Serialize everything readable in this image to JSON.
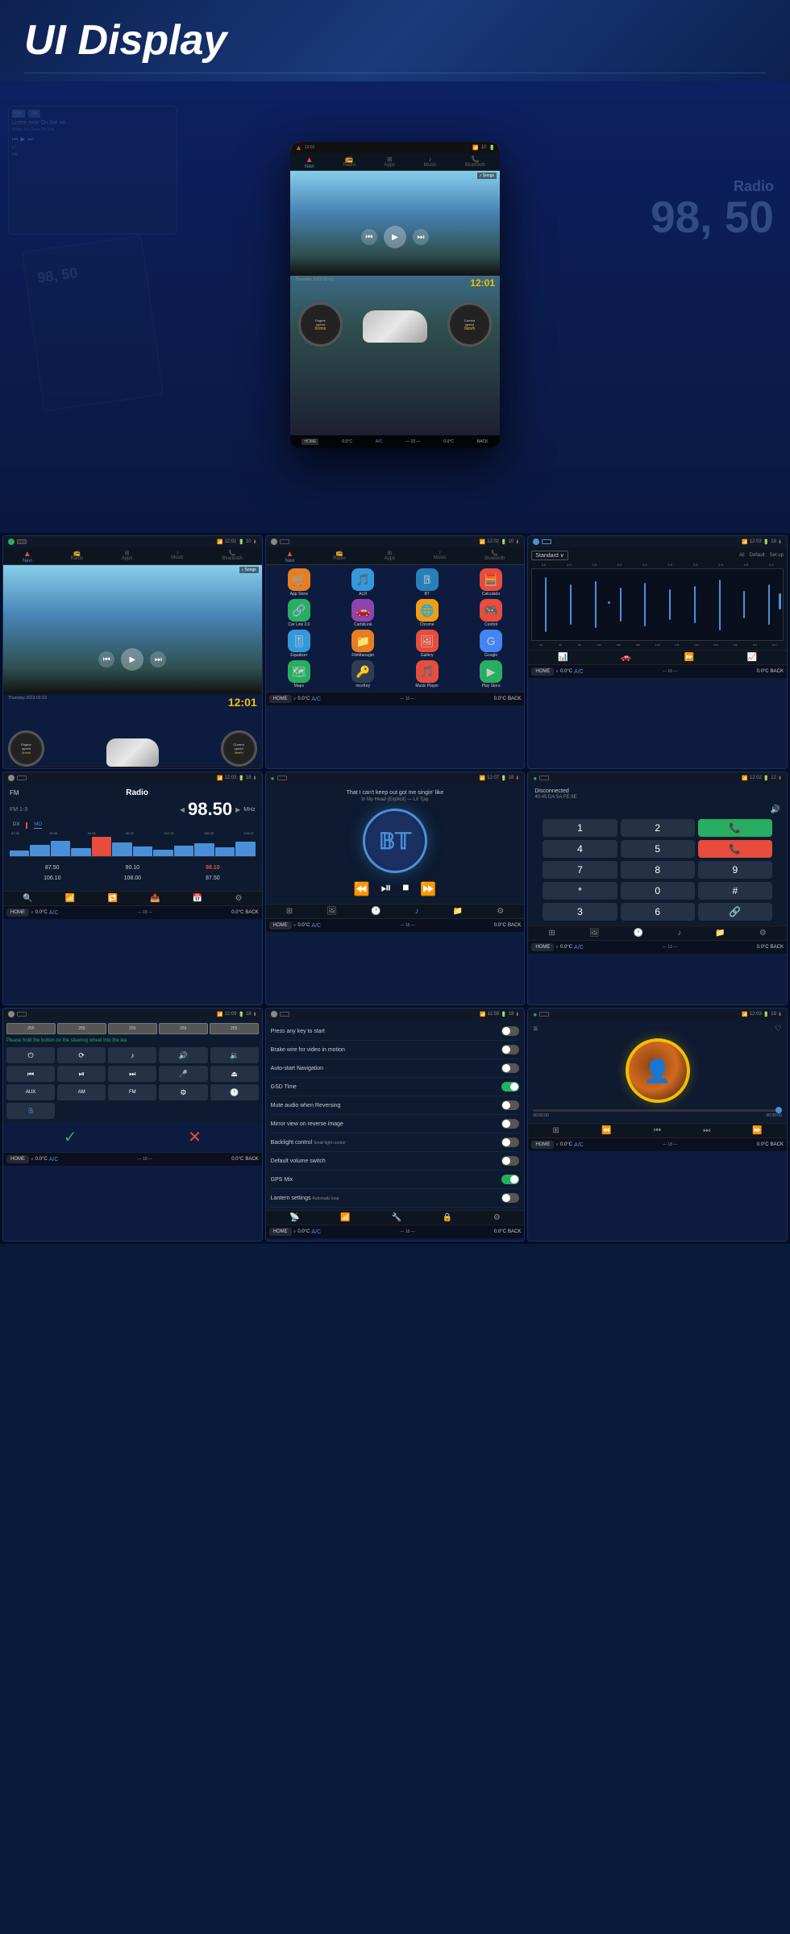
{
  "header": {
    "title": "UI Display"
  },
  "hero": {
    "radio_label": "Radio",
    "frequency": "98.50",
    "time": "12:01",
    "date": "Thursday 2022-02-03",
    "nav_items": [
      {
        "label": "Navi",
        "icon": "▲",
        "active": true
      },
      {
        "label": "Radio",
        "icon": "📻",
        "active": false
      },
      {
        "label": "Apps",
        "icon": "⊞",
        "active": false
      },
      {
        "label": "Music",
        "icon": "♪",
        "active": false
      },
      {
        "label": "Bluetooth",
        "icon": "📞",
        "active": false
      }
    ]
  },
  "screens": {
    "row1": [
      {
        "id": "home-screen",
        "status": {
          "time": "12:01",
          "battery": "10",
          "signal": "▲"
        },
        "type": "home",
        "song": "♪ Songs",
        "date": "Thursday 2022-02-03",
        "time": "12:01",
        "engine_speed": "0r/min",
        "current_speed": "0km/h"
      },
      {
        "id": "apps-screen",
        "status": {
          "time": "12:02",
          "battery": "10"
        },
        "type": "apps",
        "apps": [
          {
            "name": "App Store",
            "color": "#e67e22"
          },
          {
            "name": "AUX",
            "color": "#3498db"
          },
          {
            "name": "BT",
            "color": "#2980b9"
          },
          {
            "name": "Calculator",
            "color": "#e74c3c"
          },
          {
            "name": "Car Link 2.0",
            "color": "#27ae60"
          },
          {
            "name": "CarbitLink",
            "color": "#8e44ad"
          },
          {
            "name": "Chrome",
            "color": "#f39c12"
          },
          {
            "name": "Control",
            "color": "#e74c3c"
          },
          {
            "name": "Equalizer",
            "color": "#3498db"
          },
          {
            "name": "FileManager",
            "color": "#e67e22"
          },
          {
            "name": "Gallery",
            "color": "#e74c3c"
          },
          {
            "name": "Google",
            "color": "#4285f4"
          },
          {
            "name": "Maps",
            "color": "#27ae60"
          },
          {
            "name": "mcxKey",
            "color": "#2c3e50"
          },
          {
            "name": "Music Player",
            "color": "#e74c3c"
          },
          {
            "name": "Play Store",
            "color": "#27ae60"
          }
        ]
      },
      {
        "id": "eq-screen",
        "status": {
          "time": "12:03",
          "battery": "18"
        },
        "type": "equalizer",
        "preset": "Standard",
        "filters": [
          "All",
          "Default",
          "Set up"
        ],
        "bands": [
          "2.0",
          "2.0",
          "2.0",
          "2.0",
          "2.0",
          "2.0",
          "2.0",
          "2.0",
          "2.0",
          "2.0"
        ],
        "freqs": [
          "FC",
          "30",
          "60",
          "125",
          "200",
          "500",
          "1.0k",
          "1.5k",
          "3.0k",
          "5.0k",
          "6.3k",
          "13.0",
          "16.0"
        ]
      }
    ],
    "row2": [
      {
        "id": "radio-screen",
        "status": {
          "time": "12:03",
          "battery": "18"
        },
        "type": "radio",
        "fm_band": "FM",
        "title": "Radio",
        "band_label": "FM 1-3",
        "frequency": "98.50",
        "unit": "MHz",
        "dx": "DX",
        "mo": "MO",
        "scale": [
          "87.50",
          "90.45",
          "93.35",
          "96.30",
          "99.20",
          "102.15",
          "105.55",
          "108.00"
        ],
        "presets": [
          "87.50",
          "90.10",
          "98.10",
          "106.10",
          "108.00",
          "87.50"
        ]
      },
      {
        "id": "bt-screen",
        "status": {
          "time": "12:07",
          "battery": "18"
        },
        "type": "bluetooth",
        "song_title": "That I can't keep out got me singin' like",
        "song_sub": "In My Head (Explicit) — Lil Tjay",
        "bt_label": "BT"
      },
      {
        "id": "phone-screen",
        "status": {
          "time": "12:02",
          "battery": "12"
        },
        "type": "phone",
        "connection": "Disconnected",
        "bt_id": "40:45:DA:5A:FE:8E",
        "keypad": [
          "1",
          "2",
          "3",
          "4",
          "5",
          "6",
          "7",
          "8",
          "9",
          "*",
          "0",
          "#"
        ]
      }
    ],
    "row3": [
      {
        "id": "steering-screen",
        "status": {
          "time": "12:09",
          "battery": "18"
        },
        "type": "steering",
        "warning": "Please hold the button on the steering wheel into the lea",
        "colors": [
          "255",
          "255",
          "255",
          "255",
          "255"
        ],
        "buttons": [
          "⏻",
          "⟳",
          "🎵",
          "🔊",
          "🔉",
          "⏮",
          "⏯",
          "⏭",
          "🎤",
          "⏏",
          "AUX",
          "AM",
          "FM",
          "⚙",
          "🕐",
          "🔵"
        ]
      },
      {
        "id": "system-settings-screen",
        "status": {
          "time": "11:59",
          "battery": "18"
        },
        "type": "system-settings",
        "settings": [
          {
            "label": "Press any key to start",
            "toggle": false
          },
          {
            "label": "Brake wire for video in motion",
            "toggle": false
          },
          {
            "label": "Auto-start Navigation",
            "toggle": false
          },
          {
            "label": "GSD Time",
            "toggle": true
          },
          {
            "label": "Mute audio when Reversing",
            "toggle": false
          },
          {
            "label": "Mirror view on reverse image",
            "toggle": false
          },
          {
            "label": "Backlight control",
            "sub": "Small light control",
            "toggle": false
          },
          {
            "label": "Default volume switch",
            "toggle": false
          },
          {
            "label": "GPS Mix",
            "toggle": true
          },
          {
            "label": "Lantern settings",
            "sub": "Automatic loop",
            "toggle": false
          }
        ]
      },
      {
        "id": "music-player-screen",
        "status": {
          "time": "12:03",
          "battery": "18"
        },
        "type": "music-player",
        "progress": "00:00:00",
        "total": "00:00:00"
      }
    ]
  },
  "bottom_bar": {
    "home_label": "HOME",
    "temp": "0.0°C",
    "ac_label": "A/C",
    "back_label": "BACK"
  },
  "icons": {
    "home": "🏠",
    "back": "↩",
    "play": "▶",
    "pause": "⏸",
    "prev": "⏮",
    "next": "⏭",
    "rewind": "⏪",
    "forward": "⏩",
    "stop": "⏹",
    "phone": "📞",
    "nav": "▲",
    "radio": "📻",
    "music": "♪",
    "bt": "𝔹",
    "settings": "⚙",
    "search": "🔍",
    "equalizer": "📊"
  }
}
